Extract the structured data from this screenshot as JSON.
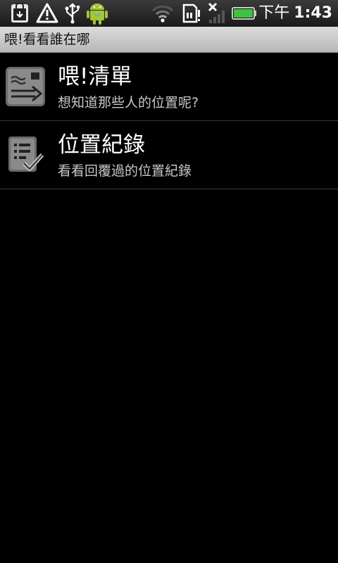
{
  "status_bar": {
    "icons": [
      "market-download-icon",
      "warning-icon",
      "usb-icon",
      "android-icon",
      "wifi-icon",
      "sd-card-icon",
      "no-signal-icon",
      "battery-icon"
    ],
    "time_period": "下午",
    "time": "1:43"
  },
  "titlebar": {
    "title": "喂!看看誰在哪"
  },
  "list": {
    "items": [
      {
        "title": "喂!清單",
        "subtitle": "想知道那些人的位置呢?",
        "icon": "list-send-icon"
      },
      {
        "title": "位置紀錄",
        "subtitle": "看看回覆過的位置紀錄",
        "icon": "checklist-icon"
      }
    ]
  }
}
